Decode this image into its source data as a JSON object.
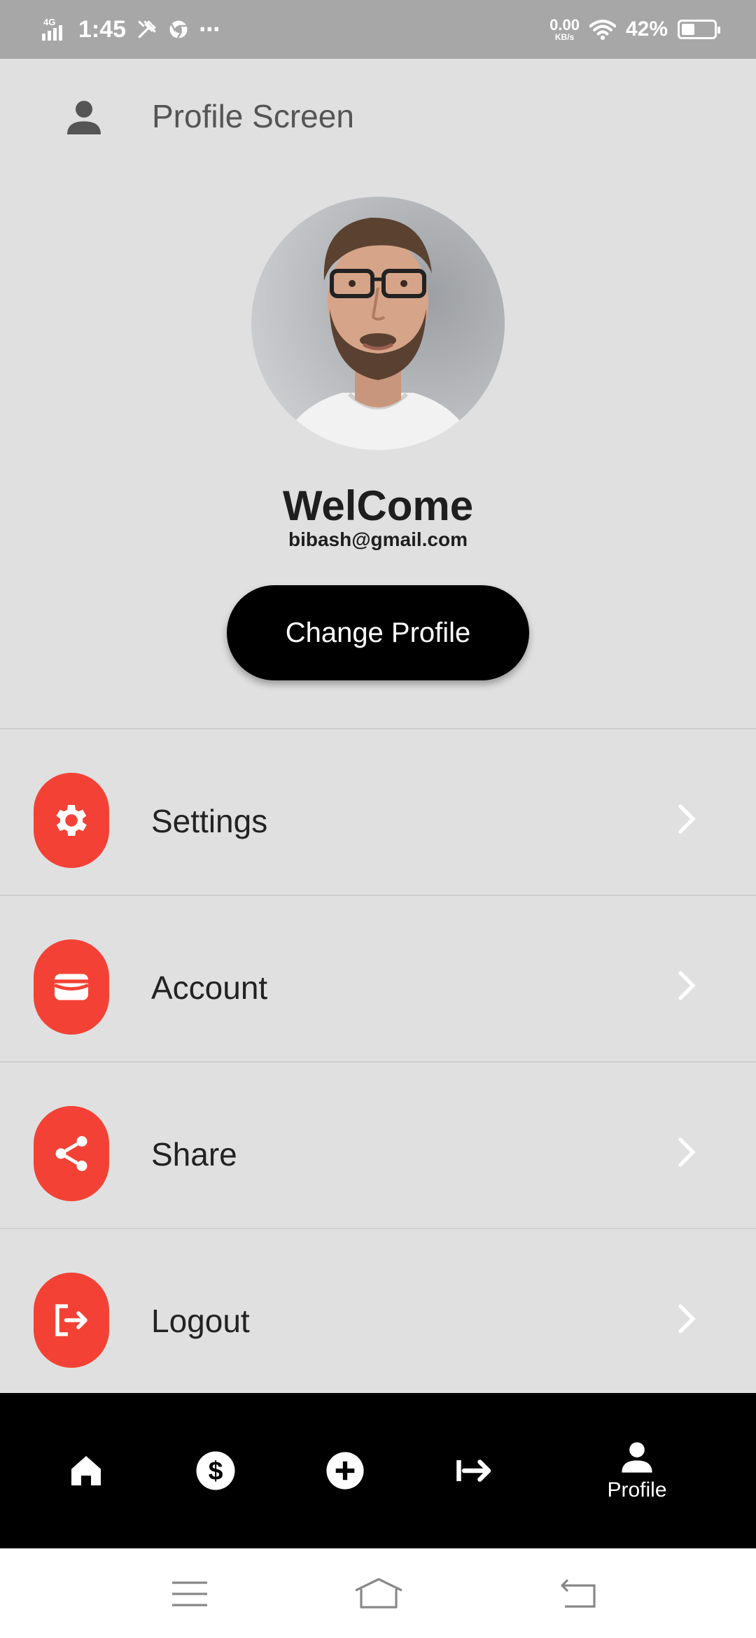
{
  "status_bar": {
    "network": "4G",
    "time": "1:45",
    "more": "⋯",
    "speed_value": "0.00",
    "speed_unit": "KB/s",
    "battery_percent": "42%",
    "battery_level": 0.42
  },
  "header": {
    "title": "Profile Screen",
    "icon": "person-icon"
  },
  "profile": {
    "greeting": "WelCome",
    "email": "bibash@gmail.com",
    "change_button": "Change Profile"
  },
  "menu": {
    "items": [
      {
        "label": "Settings",
        "icon": "gear-icon"
      },
      {
        "label": "Account",
        "icon": "wallet-icon"
      },
      {
        "label": "Share",
        "icon": "share-icon"
      },
      {
        "label": "Logout",
        "icon": "logout-icon"
      }
    ]
  },
  "bottom_nav": {
    "items": [
      {
        "icon": "home-icon"
      },
      {
        "icon": "dollar-icon"
      },
      {
        "icon": "add-circle-icon"
      },
      {
        "icon": "arrow-right-to-icon"
      },
      {
        "icon": "person-icon",
        "label": "Profile",
        "active": true
      }
    ]
  },
  "colors": {
    "accent": "#f34235",
    "background": "#e0e0e0",
    "status_bar": "#a7a7a7",
    "nav_background": "#000000"
  }
}
